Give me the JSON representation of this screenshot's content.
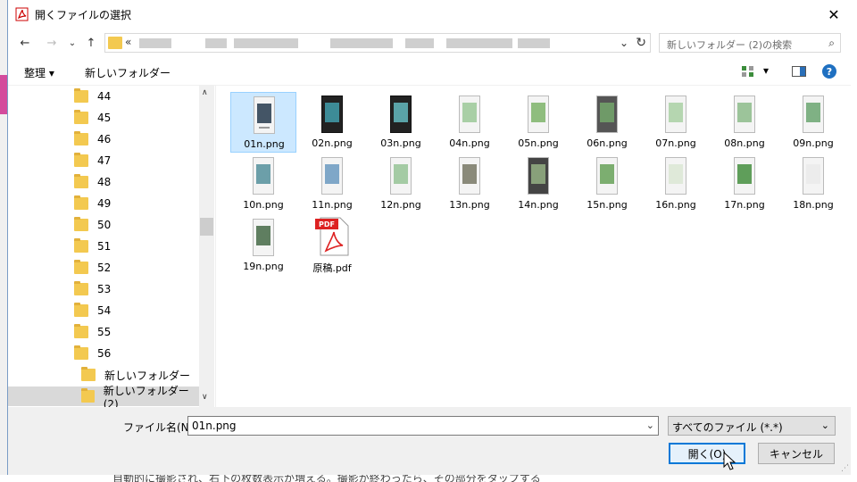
{
  "dialog": {
    "title": "開くファイルの選択",
    "close_symbol": "✕"
  },
  "nav": {
    "back": "←",
    "forward": "→",
    "recent": "⌄",
    "up": "↑",
    "address_prefix": "«",
    "address_drop": "⌄",
    "refresh": "↻",
    "search_placeholder": "新しいフォルダー (2)の検索",
    "search_symbol": "⌕"
  },
  "toolbar": {
    "organize": "整理 ▾",
    "new_folder": "新しいフォルダー",
    "view_drop": "▾",
    "help": "?"
  },
  "tree": {
    "items": [
      "44",
      "45",
      "46",
      "47",
      "48",
      "49",
      "50",
      "51",
      "52",
      "53",
      "54",
      "55",
      "56",
      "新しいフォルダー",
      "新しいフォルダー (2)"
    ],
    "scroll_up": "∧",
    "scroll_down": "∨"
  },
  "files": {
    "items": [
      "01n.png",
      "02n.png",
      "03n.png",
      "04n.png",
      "05n.png",
      "06n.png",
      "07n.png",
      "08n.png",
      "09n.png",
      "10n.png",
      "11n.png",
      "12n.png",
      "13n.png",
      "14n.png",
      "15n.png",
      "16n.png",
      "17n.png",
      "18n.png",
      "19n.png",
      "原稿.pdf"
    ],
    "pdf_badge": "PDF"
  },
  "bottom": {
    "filename_label": "ファイル名(N):",
    "filename_value": "01n.png",
    "filename_drop": "⌄",
    "filetype_value": "すべてのファイル (*.*)",
    "filetype_drop": "⌄",
    "open_label": "開く(O)",
    "cancel_label": "キャンセル",
    "grip": "⋰"
  },
  "background": {
    "text": "自動的に撮影され、右下の枚数表示が増える。撮影が終わったら、その部分をタップする"
  },
  "colors": {
    "accent": "#0078d7",
    "selection": "#cce8ff",
    "folder": "#f3c950",
    "help": "#1f70c1"
  }
}
